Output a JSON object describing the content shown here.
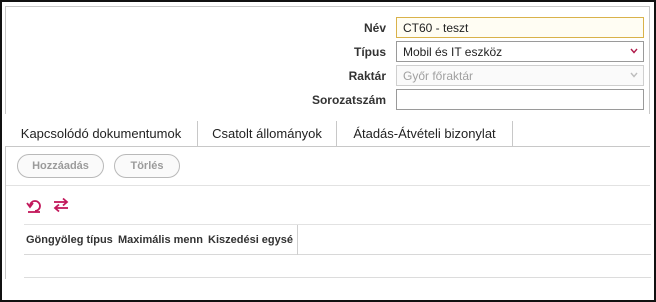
{
  "form": {
    "fields": [
      {
        "label": "Név",
        "value": "CT60 - teszt",
        "state": "active"
      },
      {
        "label": "Típus",
        "value": "Mobil és IT eszköz",
        "state": "select"
      },
      {
        "label": "Raktár",
        "value": "Győr főraktár",
        "state": "disabled"
      },
      {
        "label": "Sorozatszám",
        "value": "",
        "state": "empty"
      }
    ]
  },
  "tabs": [
    {
      "label": "Kapcsolódó dokumentumok"
    },
    {
      "label": "Csatolt állományok"
    },
    {
      "label": "Átadás-Átvételi bizonylat"
    }
  ],
  "toolbar": {
    "add_label": "Hozzáadás",
    "delete_label": "Törlés",
    "icons": [
      "undo-icon",
      "transfer-arrows-icon"
    ]
  },
  "grid": {
    "columns": [
      {
        "label": "Göngyöleg típus"
      },
      {
        "label": "Maximális menn"
      },
      {
        "label": "Kiszedési egysé"
      }
    ]
  },
  "colors": {
    "accent": "#c2185b",
    "active_border": "#d9b24a",
    "select_chevron": "#b01a4a"
  }
}
